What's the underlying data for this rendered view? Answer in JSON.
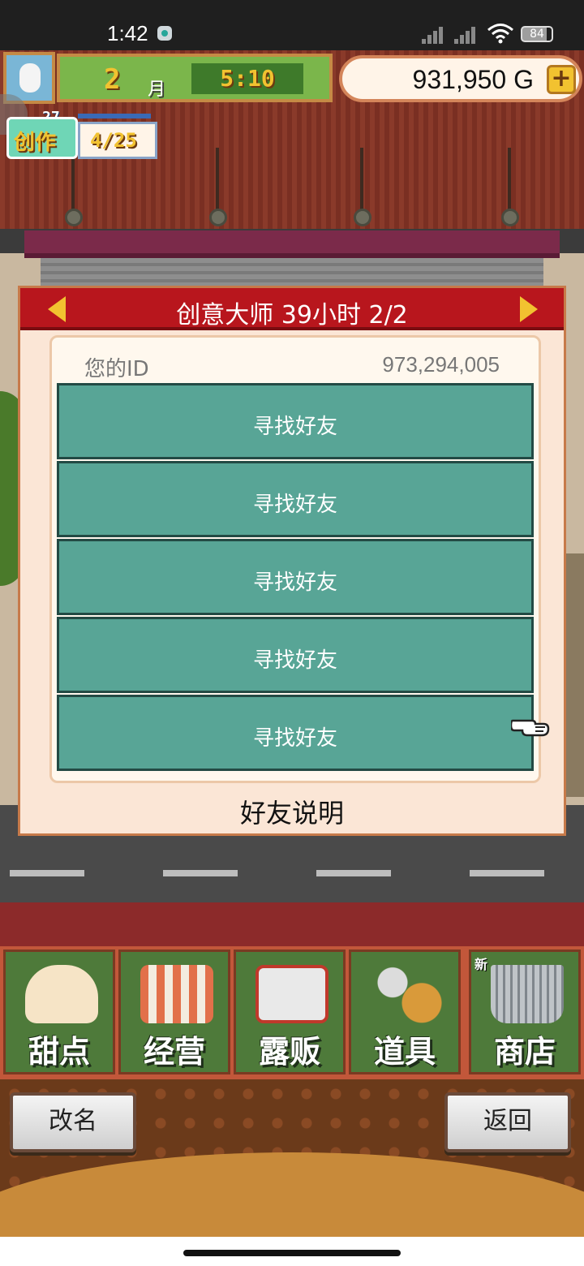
{
  "status_bar": {
    "time": "1:42",
    "battery": "84"
  },
  "hud": {
    "month": "2",
    "month_unit": "月",
    "clock": "5:10",
    "gold": "931,950 G",
    "gold_plus": "+",
    "create_label": "创作",
    "create_level": "27",
    "create_progress": "4/25"
  },
  "dialog": {
    "title": "创意大师  39小时 2/2",
    "id_label": "您的ID",
    "id_value": "973,294,005",
    "friend_slots": [
      "寻找好友",
      "寻找好友",
      "寻找好友",
      "寻找好友",
      "寻找好友"
    ],
    "help_label": "好友说明"
  },
  "menu": {
    "items": [
      {
        "label": "甜点",
        "icon": "cake-icon",
        "color": "#f6e4c6"
      },
      {
        "label": "经营",
        "icon": "shop-icon",
        "color": "#e2704a"
      },
      {
        "label": "露贩",
        "icon": "food-truck-icon",
        "color": "#e9e9e9"
      },
      {
        "label": "道具",
        "icon": "items-bag-icon",
        "color": "#d99a3a"
      },
      {
        "label": "商店",
        "icon": "cart-icon",
        "color": "#bfc4c8",
        "badge": "新"
      }
    ]
  },
  "buttons": {
    "rename": "改名",
    "back": "返回"
  },
  "colors": {
    "dialog_header": "#b8161d",
    "friend_slot": "#58a596",
    "menu_green": "#4e7a3a"
  }
}
